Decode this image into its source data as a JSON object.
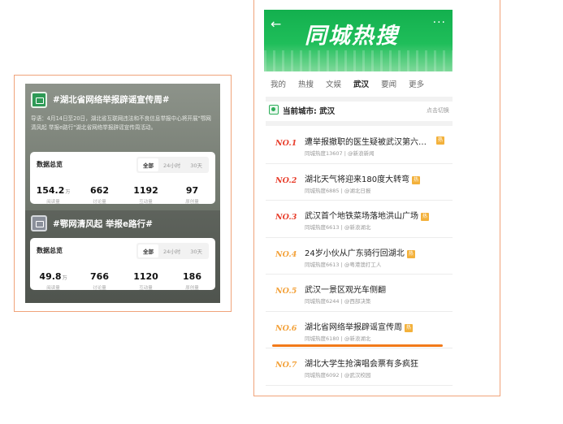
{
  "left": {
    "topic_a": {
      "title": "#湖北省网络举报辟谣宣传周#",
      "desc": "导语：4月14日至20日，湖北省互联网违法和不良信息举报中心将开展\"鄂网清风起 举报e路行\"湖北省网络举报辟谣宣传周活动。",
      "card_title": "数据总览",
      "segments": [
        "全部",
        "24小时",
        "30天"
      ],
      "stats": [
        {
          "value": "154.2",
          "unit": "万",
          "label": "阅读量"
        },
        {
          "value": "662",
          "unit": "",
          "label": "讨论量"
        },
        {
          "value": "1192",
          "unit": "",
          "label": "互动量"
        },
        {
          "value": "97",
          "unit": "",
          "label": "原创量"
        }
      ]
    },
    "topic_b": {
      "title": "#鄂网清风起 举报e路行#",
      "card_title": "数据总览",
      "segments": [
        "全部",
        "24小时",
        "30天"
      ],
      "stats": [
        {
          "value": "49.8",
          "unit": "万",
          "label": "阅读量"
        },
        {
          "value": "766",
          "unit": "",
          "label": "讨论量"
        },
        {
          "value": "1120",
          "unit": "",
          "label": "互动量"
        },
        {
          "value": "186",
          "unit": "",
          "label": "原创量"
        }
      ]
    }
  },
  "right": {
    "banner_title": "同城热搜",
    "back_icon": "←",
    "more_icon": "···",
    "tabs": [
      "我的",
      "热搜",
      "文娱",
      "武汉",
      "要闻",
      "更多"
    ],
    "active_tab": "武汉",
    "city_label": "当前城市: 武汉",
    "city_switch": "点击切换",
    "badge_text": "热",
    "items": [
      {
        "rank": "NO.1",
        "title": "遭举报撤职的医生疑被武汉第六…",
        "meta": "同城热度13607 | @新浪新闻"
      },
      {
        "rank": "NO.2",
        "title": "湖北天气将迎来180度大转弯",
        "meta": "同城热度6885 | @湖北日报"
      },
      {
        "rank": "NO.3",
        "title": "武汉首个地铁菜场落地洪山广场",
        "meta": "同城热度6613 | @新浪湖北"
      },
      {
        "rank": "NO.4",
        "title": "24岁小伙从广东骑行回湖北",
        "meta": "同城热度6613 | @粤港澳打工人"
      },
      {
        "rank": "NO.5",
        "title": "武汉一景区观光车侧翻",
        "meta": "同城热度6244 | @西部决策"
      },
      {
        "rank": "NO.6",
        "title": "湖北省网络举报辟谣宣传周",
        "meta": "同城热度6180 | @新浪湖北"
      },
      {
        "rank": "NO.7",
        "title": "湖北大学生抢演唱会票有多疯狂",
        "meta": "同城热度6092 | @武汉校园"
      }
    ],
    "colors": {
      "banner_green": "#13b04e",
      "accent_orange": "#f27a1a",
      "rank_red": "#e8402e",
      "rank_orange": "#f3a23b"
    }
  }
}
